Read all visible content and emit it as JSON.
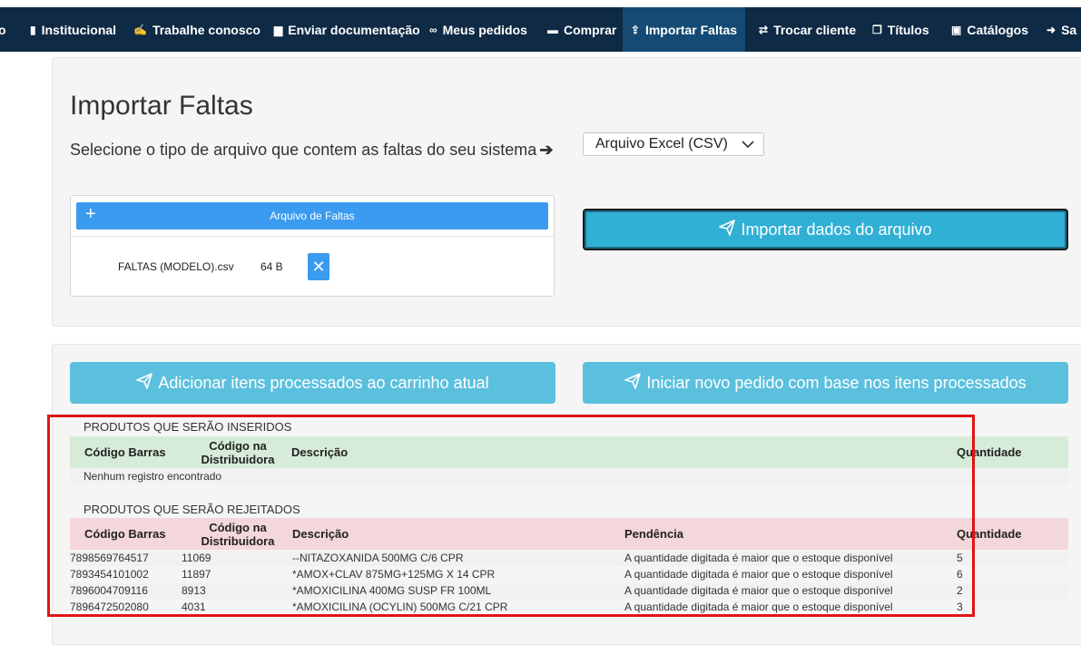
{
  "nav": {
    "items": [
      {
        "label": "o",
        "icon": ""
      },
      {
        "label": "Institucional",
        "icon": "building-icon"
      },
      {
        "label": "Trabalhe conosco",
        "icon": "handshake-icon"
      },
      {
        "label": "Enviar documentação",
        "icon": "file-icon"
      },
      {
        "label": "Meus pedidos",
        "icon": "binoculars-icon"
      },
      {
        "label": "Comprar",
        "icon": "cart-icon"
      },
      {
        "label": "Importar Faltas",
        "icon": "upload-icon",
        "active": true
      },
      {
        "label": "Trocar cliente",
        "icon": "exchange-icon"
      },
      {
        "label": "Títulos",
        "icon": "copy-icon"
      },
      {
        "label": "Catálogos",
        "icon": "picture-file-icon"
      },
      {
        "label": "Sa",
        "icon": "sign-out-icon"
      }
    ]
  },
  "page": {
    "title": "Importar Faltas",
    "subtitle": "Selecione o tipo de arquivo que contem as faltas do seu sistema",
    "file_type_select": "Arquivo Excel (CSV)",
    "upload": {
      "header": "Arquivo de Faltas",
      "plus": "+",
      "file_name": "FALTAS (MODELO).csv",
      "file_size": "64 B",
      "remove": "✕"
    },
    "import_button": "Importar dados do arquivo",
    "add_button": "Adicionar itens processados ao carrinho atual",
    "new_order_button": "Iniciar novo pedido com base nos itens processados"
  },
  "inserted": {
    "label": "PRODUTOS QUE SERÃO INSERIDOS",
    "headers": {
      "barcode": "Código Barras",
      "dist_line1": "Código na",
      "dist_line2": "Distribuidora",
      "description": "Descrição",
      "quantity": "Quantidade"
    },
    "empty": "Nenhum registro encontrado"
  },
  "rejected": {
    "label": "PRODUTOS QUE SERÃO REJEITADOS",
    "headers": {
      "barcode": "Código Barras",
      "dist_line1": "Código na",
      "dist_line2": "Distribuidora",
      "description": "Descrição",
      "pending": "Pendência",
      "quantity": "Quantidade"
    },
    "rows": [
      {
        "barcode": "7898569764517",
        "dist": "11069",
        "description": "--NITAZOXANIDA 500MG C/6 CPR",
        "pending": "A quantidade digitada é maior que o estoque disponível",
        "quantity": "5"
      },
      {
        "barcode": "7893454101002",
        "dist": "11897",
        "description": "*AMOX+CLAV 875MG+125MG X 14 CPR",
        "pending": "A quantidade digitada é maior que o estoque disponível",
        "quantity": "6"
      },
      {
        "barcode": "7896004709116",
        "dist": "8913",
        "description": "*AMOXICILINA 400MG SUSP FR 100ML",
        "pending": "A quantidade digitada é maior que o estoque disponível",
        "quantity": "2"
      },
      {
        "barcode": "7896472502080",
        "dist": "4031",
        "description": "*AMOXICILINA (OCYLIN) 500MG C/21 CPR",
        "pending": "A quantidade digitada é maior que o estoque disponível",
        "quantity": "3"
      }
    ]
  },
  "colors": {
    "navbar": "#0f2a44",
    "nav_active": "#144a73",
    "upload_blue": "#3a9bf0",
    "info_button": "#5bc0de",
    "green_header": "#d6ecd9",
    "red_header": "#f4d7da",
    "highlight": "#e11414"
  }
}
